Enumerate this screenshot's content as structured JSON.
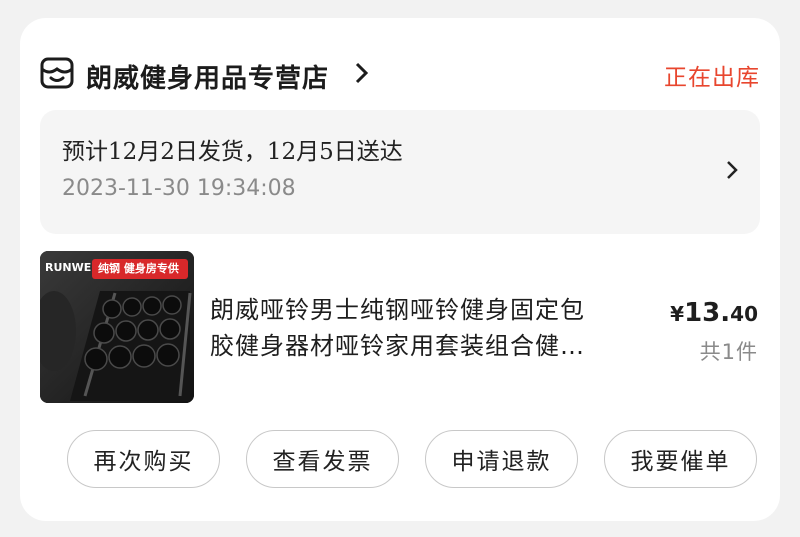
{
  "shop": {
    "name": "朗威健身用品专营店",
    "status": "正在出库",
    "icon": "shop-icon"
  },
  "delivery": {
    "estimate": "预计12月2日发货，12月5日送达",
    "timestamp": "2023-11-30 19:34:08"
  },
  "product": {
    "thumbnail_brand": "RUNWE",
    "thumbnail_banner": "纯钢 健身房专供",
    "title_line1": "朗威哑铃男士纯钢哑铃健身固定包",
    "title_line2": "胶健身器材哑铃家用套装组合健…",
    "price_symbol": "¥",
    "price_int": "13.",
    "price_dec": "40",
    "quantity": "共1件"
  },
  "actions": [
    {
      "label": "再次购买"
    },
    {
      "label": "查看发票"
    },
    {
      "label": "申请退款"
    },
    {
      "label": "我要催单"
    }
  ],
  "colors": {
    "status": "#e8462e",
    "card": "#ffffff",
    "page": "#f2f2f2"
  }
}
